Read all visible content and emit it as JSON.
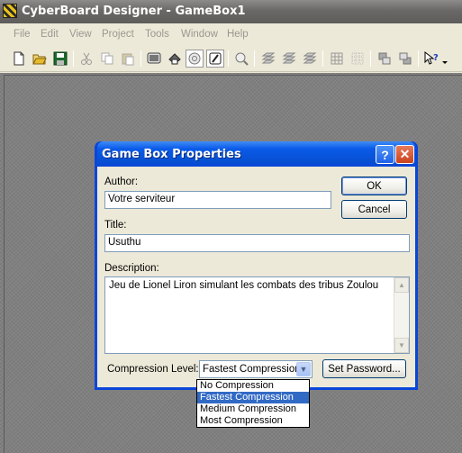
{
  "app": {
    "title": "CyberBoard Designer - GameBox1"
  },
  "menubar": {
    "items": [
      "File",
      "Edit",
      "View",
      "Project",
      "Tools",
      "Window",
      "Help"
    ]
  },
  "toolbar": {
    "icons": [
      "new-file-icon",
      "open-folder-icon",
      "save-icon",
      "cut-icon",
      "copy-icon",
      "paste-icon",
      "board-icon",
      "tile-icon",
      "rotate-icon",
      "no-icon",
      "zoom-icon",
      "layer-1-icon",
      "layer-2-icon",
      "layer-3-icon",
      "grid-icon",
      "dotted-grid-icon",
      "send-back-icon",
      "bring-front-icon",
      "context-help-icon"
    ]
  },
  "dialog": {
    "title": "Game Box Properties",
    "help_label": "?",
    "close_label": "✕",
    "author_label": "Author:",
    "author_value": "Votre serviteur",
    "title_label": "Title:",
    "title_value": "Usuthu",
    "description_label": "Description:",
    "description_value": "Jeu de Lionel Liron simulant les combats des tribus Zoulou",
    "ok_label": "OK",
    "cancel_label": "Cancel",
    "compression_label": "Compression Level:",
    "compression_value": "Fastest Compression",
    "set_password_label": "Set Password..."
  },
  "compression_options": {
    "items": [
      "No Compression",
      "Fastest Compression",
      "Medium Compression",
      "Most Compression"
    ],
    "selected": "Fastest Compression"
  }
}
